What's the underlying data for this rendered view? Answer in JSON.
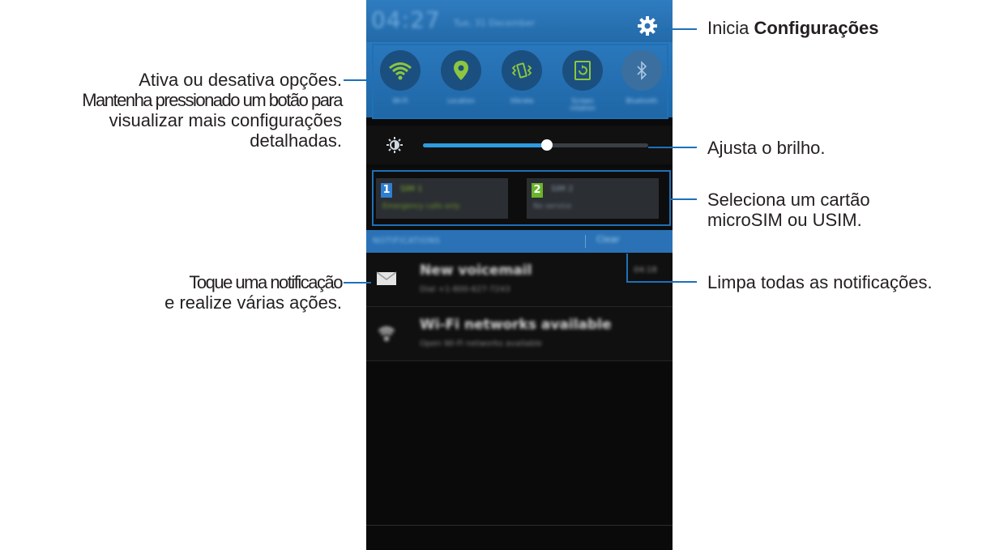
{
  "statusbar": {
    "time": "04:27",
    "date": "Tue, 31 December",
    "settings_icon": "gear-icon"
  },
  "quick_settings": [
    {
      "label": "Wi-Fi",
      "icon": "wifi-icon",
      "state": "on"
    },
    {
      "label": "Location",
      "icon": "location-icon",
      "state": "on"
    },
    {
      "label": "Vibrate",
      "icon": "vibrate-icon",
      "state": "on"
    },
    {
      "label": "Screen rotation",
      "icon": "screen-rotation-icon",
      "state": "on"
    },
    {
      "label": "Bluetooth",
      "icon": "bluetooth-icon",
      "state": "off"
    }
  ],
  "brightness": {
    "icon": "brightness-sun-icon",
    "level": 0.55
  },
  "sim": [
    {
      "number": "1",
      "name": "SIM 1",
      "status": "Emergency calls only",
      "badge_color": "#2e7fd0"
    },
    {
      "number": "2",
      "name": "SIM 2",
      "status": "No service",
      "badge_color": "#6ab42a"
    }
  ],
  "notifications_header": {
    "title": "NOTIFICATIONS",
    "clear_label": "Clear"
  },
  "notifications": [
    {
      "title": "New voicemail",
      "subtitle": "Dial +1-800-627-7243",
      "time": "04:18",
      "icon": "voicemail-envelope-icon"
    },
    {
      "title": "Wi-Fi networks available",
      "subtitle": "Open Wi-Fi networks available",
      "time": "",
      "icon": "wifi-signal-icon"
    }
  ],
  "annotations": {
    "settings_prefix": "Inicia ",
    "settings_bold": "Configurações",
    "quick_line1": "Ativa ou desativa opções.",
    "quick_line2": "Mantenha pressionado um botão para",
    "quick_line3": "visualizar mais configurações",
    "quick_line4": "detalhadas.",
    "brightness": "Ajusta o brilho.",
    "sim_line1": "Seleciona um cartão",
    "sim_line2": "microSIM ou USIM.",
    "notif_line1": "Toque uma notificação",
    "notif_line2": "e realize várias ações.",
    "clear": "Limpa todas as notificações."
  },
  "colors": {
    "accent": "#1e70b8",
    "quick_panel": "#2a78bd",
    "wifi_green": "#8cc63f"
  }
}
